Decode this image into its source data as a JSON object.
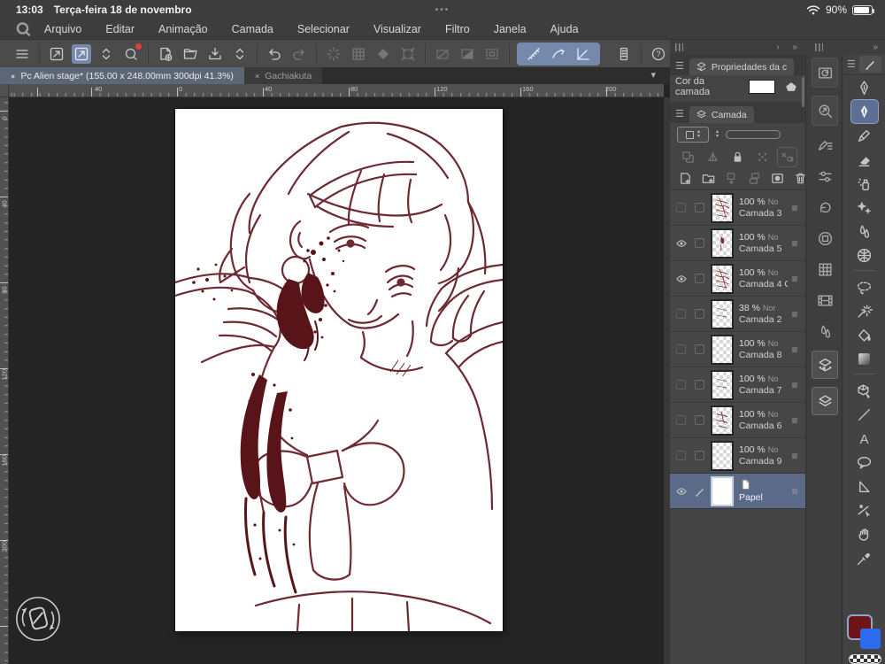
{
  "status_bar": {
    "time": "13:03",
    "date": "Terça-feira 18 de novembro",
    "battery_percent": "90%",
    "center_dots": "•••"
  },
  "menu_bar": {
    "items": [
      "Arquivo",
      "Editar",
      "Animação",
      "Camada",
      "Selecionar",
      "Visualizar",
      "Filtro",
      "Janela",
      "Ajuda"
    ]
  },
  "command_bar": {
    "groups": [
      [
        {
          "name": "hamburger-menu"
        }
      ],
      [
        {
          "name": "pan-tool"
        },
        {
          "name": "gesture-tool",
          "state": "selected"
        },
        {
          "name": "collapse-chevrons"
        },
        {
          "name": "clip-studio-app",
          "badge": true
        }
      ],
      [
        {
          "name": "new-canvas"
        },
        {
          "name": "open-file"
        },
        {
          "name": "save-file"
        },
        {
          "name": "collapse-chevrons"
        }
      ],
      [
        {
          "name": "undo"
        },
        {
          "name": "redo",
          "state": "disabled"
        }
      ],
      [
        {
          "name": "sync",
          "state": "disabled"
        },
        {
          "name": "pixel-grid",
          "state": "disabled"
        },
        {
          "name": "material",
          "state": "disabled"
        },
        {
          "name": "frame-border",
          "state": "disabled"
        }
      ],
      [
        {
          "name": "deselect",
          "state": "disabled"
        },
        {
          "name": "invert-selection",
          "state": "disabled"
        },
        {
          "name": "selection-border",
          "state": "disabled"
        }
      ],
      [
        {
          "name": "snap-ruler",
          "state": "snap"
        },
        {
          "name": "snap-special-ruler",
          "state": "snap"
        },
        {
          "name": "snap-guide",
          "state": "snap"
        }
      ],
      [
        {
          "name": "edge-keyboard"
        }
      ],
      [
        {
          "name": "help"
        }
      ]
    ]
  },
  "document_tabs": [
    {
      "label": "Pc Alien stage* (155.00 x 248.00mm 300dpi 41.3%)",
      "active": true
    },
    {
      "label": "Gachiakuta",
      "active": false
    }
  ],
  "rulers": {
    "horizontal_labels": [
      "40",
      "0",
      "40",
      "80",
      "120",
      "160",
      "200"
    ],
    "vertical_labels": [
      "0",
      "40",
      "80",
      "120",
      "160",
      "200"
    ]
  },
  "layer_properties_panel": {
    "title": "Propriedades da camad",
    "layer_color_label": "Cor da camada"
  },
  "layer_panel": {
    "title": "Camada",
    "lock_icons": [
      "clip-to-layer-below",
      "ruler-range",
      "lock-layer",
      "lock-transparent-pixels",
      "reference-layer"
    ],
    "action_icons": [
      "new-layer",
      "new-folder",
      "transfer-to-lower",
      "merge-to-lower",
      "layer-mask",
      "delete-layer"
    ],
    "layers": [
      {
        "name": "Camada 3",
        "opacity": "100 %",
        "mode": "No",
        "visible": false,
        "thumb": "dense"
      },
      {
        "name": "Camada 5",
        "opacity": "100 %",
        "mode": "No",
        "visible": true,
        "thumb": "mark"
      },
      {
        "name": "Camada 4 C",
        "opacity": "100 %",
        "mode": "No",
        "visible": true,
        "thumb": "dense"
      },
      {
        "name": "Camada 2",
        "opacity": "38 %",
        "mode": "Nor",
        "visible": false,
        "thumb": "light"
      },
      {
        "name": "Camada 8",
        "opacity": "100 %",
        "mode": "No",
        "visible": false,
        "thumb": "empty"
      },
      {
        "name": "Camada 7",
        "opacity": "100 %",
        "mode": "No",
        "visible": false,
        "thumb": "light"
      },
      {
        "name": "Camada 6",
        "opacity": "100 %",
        "mode": "No",
        "visible": false,
        "thumb": "medium"
      },
      {
        "name": "Camada 9",
        "opacity": "100 %",
        "mode": "No",
        "visible": false,
        "thumb": "empty"
      },
      {
        "name": "Papel",
        "visible": true,
        "selected": true,
        "thumb": "paper",
        "is_paper": true
      }
    ]
  },
  "panel_rail": {
    "icons": [
      {
        "name": "quick-access",
        "boxed": true
      },
      {
        "name": "navigator",
        "boxed": true
      },
      {
        "name": "sub-tool"
      },
      {
        "name": "tool-property"
      },
      {
        "name": "color-wheel"
      },
      {
        "name": "color-slider"
      },
      {
        "name": "color-set"
      },
      {
        "name": "timeline"
      },
      {
        "name": "color-mixing"
      },
      {
        "name": "layer-property",
        "active": true
      },
      {
        "name": "layer",
        "active": true
      }
    ]
  },
  "tool_bar": {
    "tools": [
      {
        "name": "pen"
      },
      {
        "name": "pen-2",
        "selected": true
      },
      {
        "name": "brush"
      },
      {
        "name": "eraser"
      },
      {
        "name": "airbrush"
      },
      {
        "name": "decoration"
      },
      {
        "name": "blend"
      },
      {
        "name": "liquify"
      },
      {
        "name": "lasso-select"
      },
      {
        "name": "auto-select"
      },
      {
        "name": "fill"
      },
      {
        "name": "gradient"
      },
      {
        "name": "object"
      },
      {
        "name": "figure"
      },
      {
        "name": "text"
      },
      {
        "name": "balloon"
      },
      {
        "name": "ruler"
      },
      {
        "name": "line-correction"
      },
      {
        "name": "hand"
      },
      {
        "name": "eyedropper"
      }
    ]
  },
  "colors": {
    "foreground": "#6e1518",
    "background": "#2c6bef",
    "toolbar_selection": "#7489ab",
    "row_selection": "#5a6a88",
    "sketch_line": "#6d2a31",
    "sketch_blood": "#581418"
  }
}
